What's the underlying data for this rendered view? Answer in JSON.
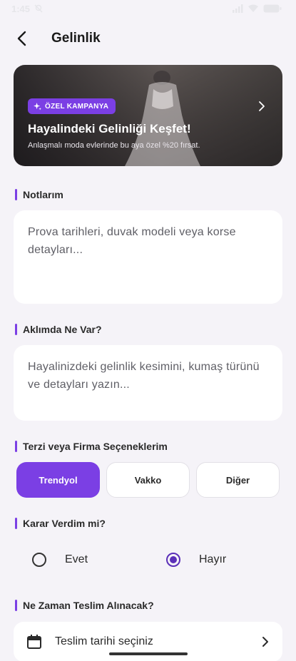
{
  "status_bar": {
    "time": "1:45"
  },
  "header": {
    "title": "Gelinlik"
  },
  "banner": {
    "badge": "ÖZEL KAMPANYA",
    "title": "Hayalindeki Gelinliği Keşfet!",
    "subtitle": "Anlaşmalı moda evlerinde bu aya özel %20 fırsat."
  },
  "notes": {
    "label": "Notlarım",
    "placeholder": "Prova tarihleri, duvak modeli veya korse detayları..."
  },
  "ideas": {
    "label": "Aklımda Ne Var?",
    "placeholder": "Hayalinizdeki gelinlik kesimini, kumaş türünü ve detayları yazın..."
  },
  "vendors": {
    "label": "Terzi veya Firma Seçeneklerim",
    "options": [
      "Trendyol",
      "Vakko",
      "Diğer"
    ],
    "selected": "Trendyol"
  },
  "decision": {
    "label": "Karar Verdim mi?",
    "options": [
      "Evet",
      "Hayır"
    ],
    "selected": "Hayır"
  },
  "delivery": {
    "label": "Ne Zaman Teslim Alınacak?",
    "placeholder": "Teslim tarihi seçiniz"
  },
  "colors": {
    "accent": "#7b3fe4",
    "background": "#f5f3f8"
  }
}
